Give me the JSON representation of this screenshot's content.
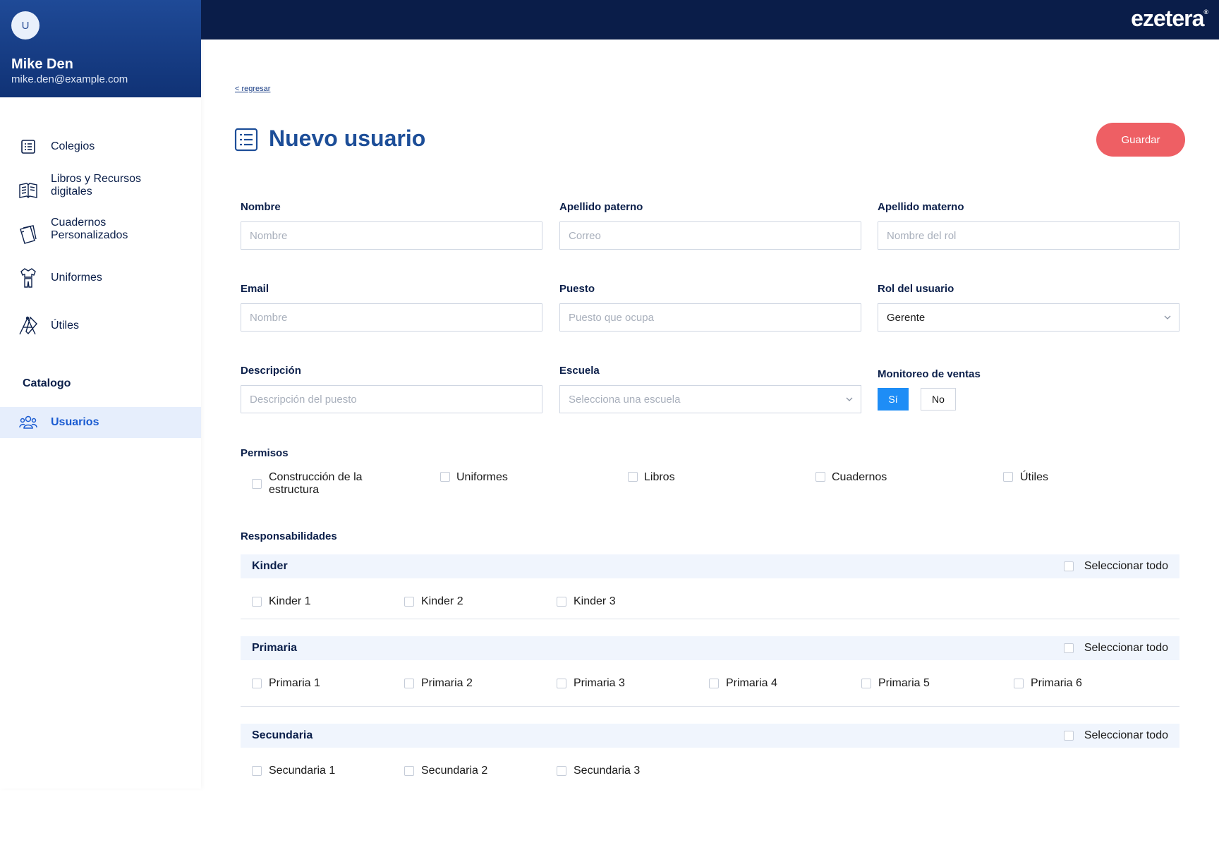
{
  "user": {
    "avatar_initial": "U",
    "name": "Mike Den",
    "email": "mike.den@example.com"
  },
  "brand": {
    "logo": "ezetera",
    "mark": "®"
  },
  "nav": {
    "items": [
      {
        "label": "Colegios",
        "icon": "list-icon"
      },
      {
        "label": "Libros y Recursos digitales",
        "icon": "book-icon"
      },
      {
        "label": "Cuadernos Personalizados",
        "icon": "notebook-icon"
      },
      {
        "label": "Uniformes",
        "icon": "uniform-icon"
      },
      {
        "label": "Útiles",
        "icon": "school-supplies-icon"
      }
    ],
    "catalog_heading": "Catalogo",
    "active_item": {
      "label": "Usuarios",
      "icon": "users-icon"
    }
  },
  "page": {
    "back_link": "< regresar",
    "title": "Nuevo usuario",
    "save_label": "Guardar"
  },
  "form": {
    "nombre": {
      "label": "Nombre",
      "placeholder": "Nombre"
    },
    "apellido_paterno": {
      "label": "Apellido paterno",
      "placeholder": "Correo"
    },
    "apellido_materno": {
      "label": "Apellido materno",
      "placeholder": "Nombre del rol"
    },
    "email": {
      "label": "Email",
      "placeholder": "Nombre"
    },
    "puesto": {
      "label": "Puesto",
      "placeholder": "Puesto que ocupa"
    },
    "rol": {
      "label": "Rol del usuario",
      "value": "Gerente"
    },
    "descripcion": {
      "label": "Descripción",
      "placeholder": "Descripción del puesto"
    },
    "escuela": {
      "label": "Escuela",
      "placeholder": "Selecciona una escuela"
    },
    "monitoreo": {
      "label": "Monitoreo de ventas",
      "yes": "Sí",
      "no": "No",
      "selected": "Sí"
    }
  },
  "permisos": {
    "label": "Permisos",
    "items": [
      "Construcción de la estructura",
      "Uniformes",
      "Libros",
      "Cuadernos",
      "Útiles"
    ]
  },
  "responsabilidades": {
    "label": "Responsabilidades",
    "select_all_label": "Seleccionar todo",
    "sections": [
      {
        "title": "Kinder",
        "items": [
          "Kinder 1",
          "Kinder 2",
          "Kinder 3"
        ]
      },
      {
        "title": "Primaria",
        "items": [
          "Primaria 1",
          "Primaria 2",
          "Primaria 3",
          "Primaria 4",
          "Primaria 5",
          "Primaria 6"
        ]
      },
      {
        "title": "Secundaria",
        "items": [
          "Secundaria 1",
          "Secundaria 2",
          "Secundaria 3"
        ]
      }
    ]
  },
  "colors": {
    "topbar": "#0a1d49",
    "accent": "#1d4e98",
    "save": "#ee5f64",
    "toggle_on": "#1e8df6"
  }
}
